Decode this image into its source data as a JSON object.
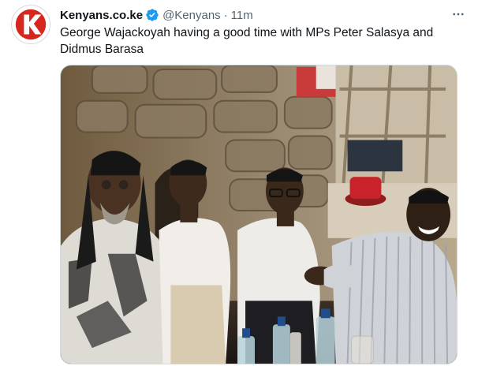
{
  "tweet": {
    "display_name": "Kenyans.co.ke",
    "handle": "@Kenyans",
    "separator": "·",
    "timestamp": "11m",
    "text": "George Wajackoyah having a good time with MPs Peter Salasya and Didmus Barasa"
  },
  "avatar": {
    "icon": "kenyans-logo-icon",
    "brand_color": "#d7261e"
  },
  "verified": {
    "icon": "verified-badge-icon",
    "color": "#1d9bf0"
  },
  "more": {
    "icon": "more-options-icon"
  },
  "media": {
    "kind": "photo"
  }
}
